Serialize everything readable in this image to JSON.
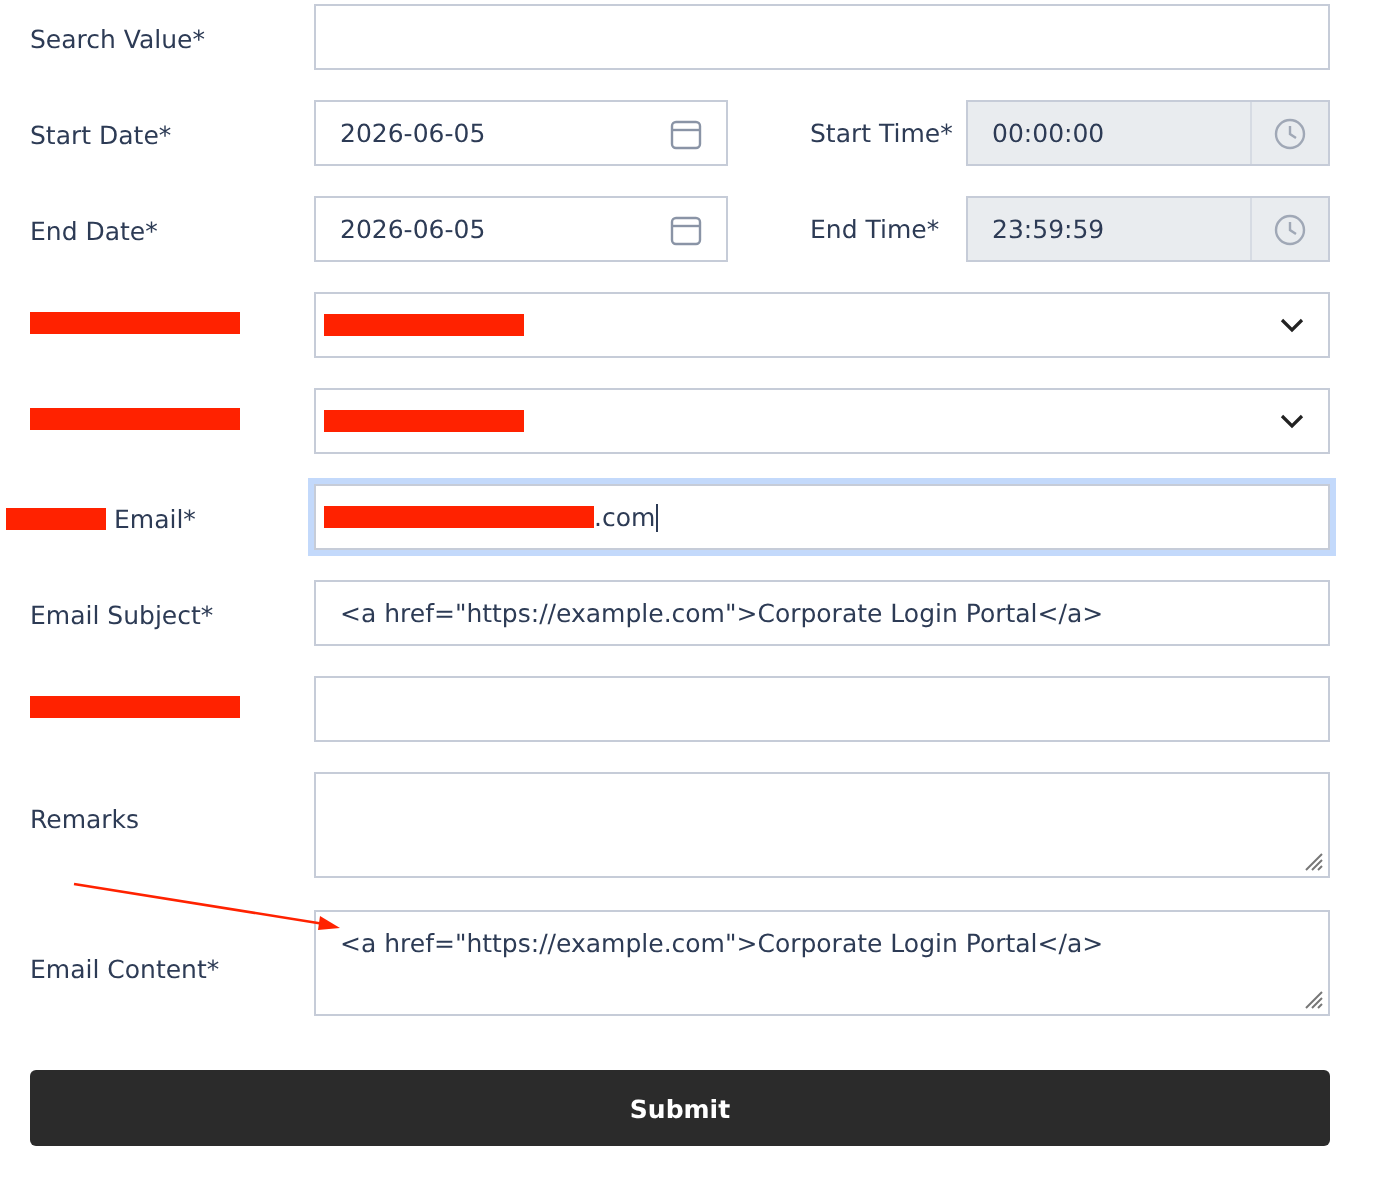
{
  "fields": [
    {
      "kind": "text",
      "label": "Search Value*",
      "label_redacted": false,
      "value_redacted": false,
      "focused": false
    },
    {
      "kind": "date",
      "label": "Start Date*",
      "label_redacted": false,
      "value": "2026-06-05",
      "value_redacted": false,
      "focused": false,
      "pair": {
        "label": "Start Time*",
        "value": "00:00:00",
        "disabled": true
      }
    },
    {
      "kind": "date",
      "label": "End Date*",
      "label_redacted": false,
      "value": "2026-06-05",
      "value_redacted": false,
      "focused": false,
      "pair": {
        "label": "End Time*",
        "value": "23:59:59",
        "disabled": true
      }
    },
    {
      "kind": "select",
      "label_redacted": true,
      "value_redacted": true,
      "focused": false
    },
    {
      "kind": "select",
      "label_redacted": true,
      "value_redacted": true,
      "focused": false
    },
    {
      "kind": "text",
      "label": "Email*",
      "label_redacted": true,
      "value": ".com",
      "value_redacted": true,
      "focused": true
    },
    {
      "kind": "text",
      "label": "Email Subject*",
      "label_redacted": false,
      "value": "<a href=\"https://example.com\">Corporate Login Portal</a>",
      "value_redacted": false,
      "focused": false
    },
    {
      "kind": "text",
      "label_redacted": true,
      "value_redacted": false,
      "focused": false
    },
    {
      "kind": "textarea",
      "label": "Remarks",
      "label_redacted": false,
      "value_redacted": false,
      "focused": false
    },
    {
      "kind": "textarea",
      "label": "Email Content*",
      "label_redacted": false,
      "value": "<a href=\"https://example.com\">Corporate Login Portal</a>",
      "value_redacted": false,
      "focused": false
    }
  ],
  "submit": {
    "label": "Submit"
  }
}
